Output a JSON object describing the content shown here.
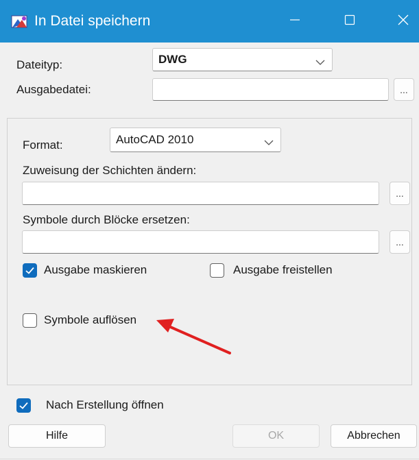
{
  "window": {
    "title": "In Datei speichern",
    "icon": "app-icon",
    "titlebar_color": "#1f8fd1",
    "controls": [
      "minimize-icon",
      "maximize-icon",
      "close-icon"
    ]
  },
  "dateityp": {
    "label": "Dateityp:",
    "value": "DWG"
  },
  "ausgabedatei": {
    "label": "Ausgabedatei:",
    "value": "",
    "browse_label": "..."
  },
  "panel": {
    "format": {
      "label": "Format:",
      "value": "AutoCAD 2010"
    },
    "schichten": {
      "label": "Zuweisung der Schichten ändern:",
      "value": "",
      "browse_label": "..."
    },
    "symbole": {
      "label": "Symbole durch Blöcke ersetzen:",
      "value": "",
      "browse_label": "..."
    },
    "ausgabe_maskieren": {
      "label": "Ausgabe maskieren",
      "checked": true
    },
    "ausgabe_freistellen": {
      "label": "Ausgabe freistellen",
      "checked": false
    },
    "symbole_aufloesen": {
      "label": "Symbole auflösen",
      "checked": false
    },
    "annotation": {
      "type": "arrow",
      "color": "#e02020"
    }
  },
  "nach_erstellung": {
    "label": "Nach Erstellung öffnen",
    "checked": true
  },
  "buttons": {
    "hilfe": "Hilfe",
    "ok": "OK",
    "abbrechen": "Abbrechen"
  },
  "accent_color": "#0f6cbd"
}
